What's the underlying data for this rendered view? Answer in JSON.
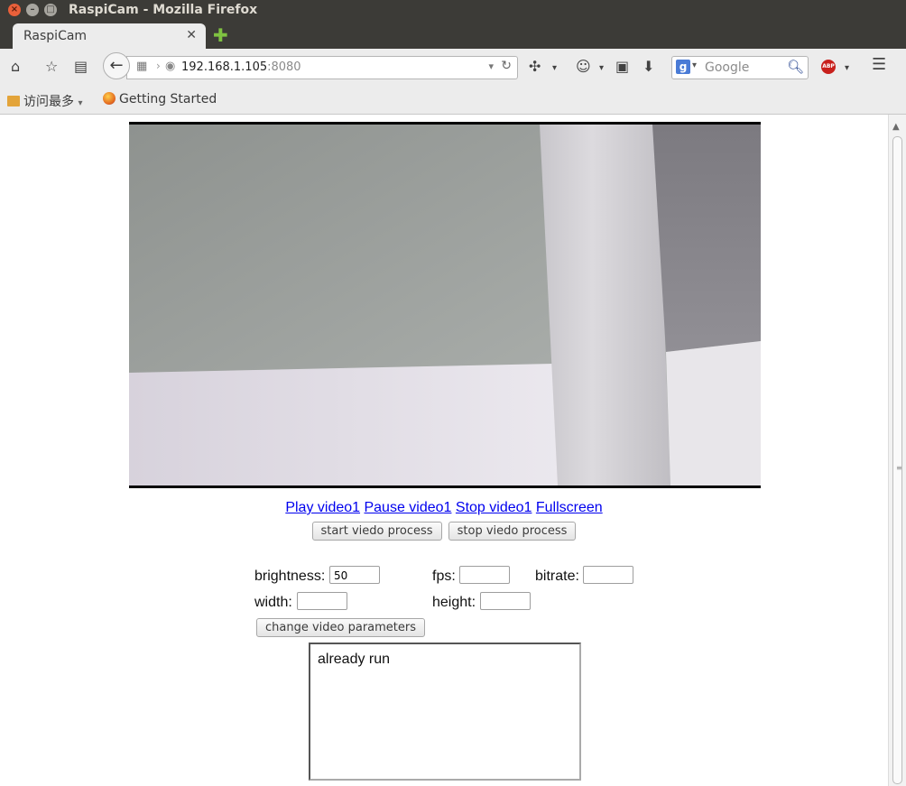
{
  "window": {
    "title": "RaspiCam - Mozilla Firefox"
  },
  "tab": {
    "label": "RaspiCam"
  },
  "urlbar": {
    "host": "192.168.1.105",
    "port": ":8080"
  },
  "search": {
    "placeholder": "Google"
  },
  "bookmarks": {
    "most_visited": "访问最多",
    "getting_started": "Getting Started"
  },
  "video_links": {
    "play": "Play video1",
    "pause": "Pause video1",
    "stop": "Stop video1",
    "fullscreen": "Fullscreen"
  },
  "process_buttons": {
    "start": "start viedo process",
    "stop": "stop viedo process"
  },
  "params": {
    "brightness_label": "brightness:",
    "brightness_value": "50",
    "fps_label": "fps:",
    "fps_value": "",
    "bitrate_label": "bitrate:",
    "bitrate_value": "",
    "width_label": "width:",
    "width_value": "",
    "height_label": "height:",
    "height_value": "",
    "change_button": "change video parameters"
  },
  "status": {
    "text": "already run"
  }
}
